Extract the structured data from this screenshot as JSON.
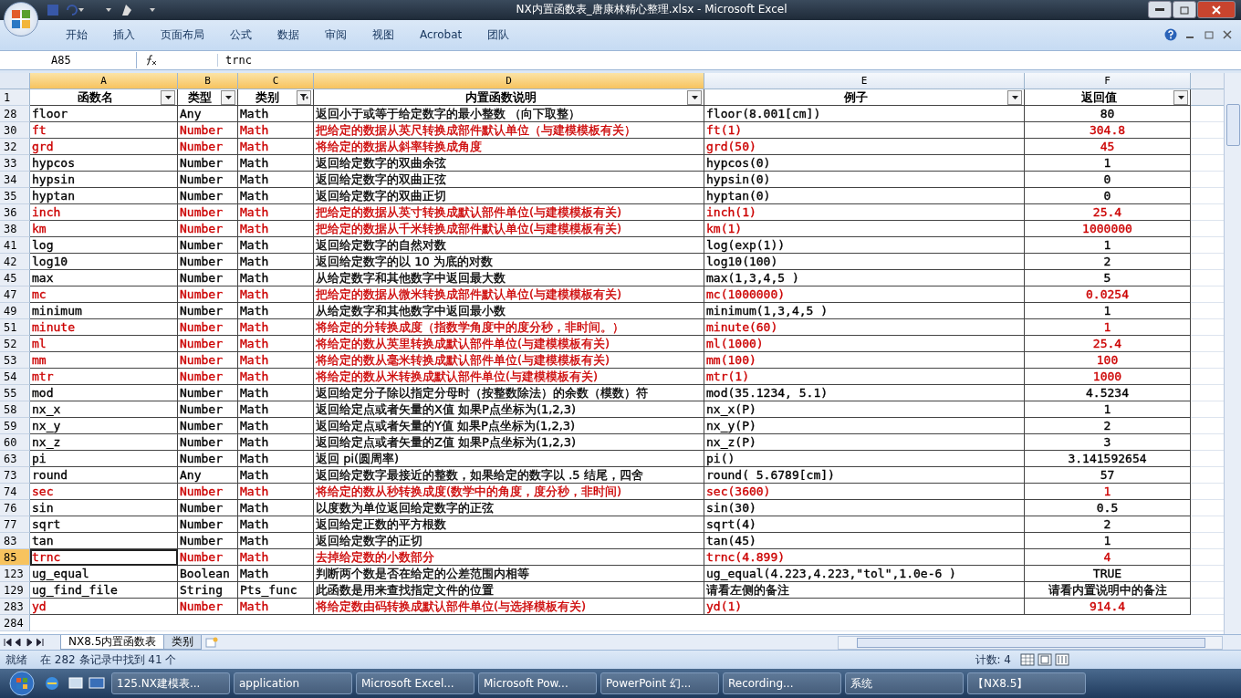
{
  "window": {
    "title": "NX内置函数表_唐康林精心整理.xlsx - Microsoft Excel"
  },
  "ribbon_tabs": [
    "开始",
    "插入",
    "页面布局",
    "公式",
    "数据",
    "审阅",
    "视图",
    "Acrobat",
    "团队"
  ],
  "formula_bar": {
    "name_box": "A85",
    "value": "trnc"
  },
  "columns": [
    {
      "letter": "A",
      "label": "函数名",
      "selected": true,
      "filtered": false
    },
    {
      "letter": "B",
      "label": "类型",
      "selected": true,
      "filtered": false
    },
    {
      "letter": "C",
      "label": "类别",
      "selected": true,
      "filtered": true
    },
    {
      "letter": "D",
      "label": "内置函数说明",
      "selected": true,
      "filtered": false
    },
    {
      "letter": "E",
      "label": "例子",
      "selected": false,
      "filtered": false
    },
    {
      "letter": "F",
      "label": "返回值",
      "selected": false,
      "filtered": false
    }
  ],
  "header_row": "1",
  "rows": [
    {
      "row": "28",
      "cells": [
        "floor",
        "Any",
        "Math",
        "返回小于或等于给定数字的最小整数 （向下取整）",
        "floor(8.001[cm])",
        "80"
      ],
      "color": "#000000",
      "selected": false
    },
    {
      "row": "30",
      "cells": [
        "ft",
        "Number",
        "Math",
        "把给定的数据从英尺转换成部件默认单位（与建模模板有关）",
        "ft(1)",
        "304.8"
      ],
      "color": "#cc0000",
      "selected": false
    },
    {
      "row": "32",
      "cells": [
        "grd",
        "Number",
        "Math",
        "将给定的数据从斜率转换成角度",
        "grd(50)",
        "45"
      ],
      "color": "#cc0000",
      "selected": false
    },
    {
      "row": "33",
      "cells": [
        "hypcos",
        "Number",
        "Math",
        "返回给定数字的双曲余弦",
        "hypcos(0)",
        "1"
      ],
      "color": "#000000",
      "selected": false
    },
    {
      "row": "34",
      "cells": [
        "hypsin",
        "Number",
        "Math",
        "返回给定数字的双曲正弦",
        "hypsin(0)",
        "0"
      ],
      "color": "#000000",
      "selected": false
    },
    {
      "row": "35",
      "cells": [
        "hyptan",
        "Number",
        "Math",
        "返回给定数字的双曲正切",
        "hyptan(0)",
        "0"
      ],
      "color": "#000000",
      "selected": false
    },
    {
      "row": "36",
      "cells": [
        "inch",
        "Number",
        "Math",
        "把给定的数据从英寸转换成默认部件单位(与建模模板有关)",
        "inch(1)",
        "25.4"
      ],
      "color": "#cc0000",
      "selected": false
    },
    {
      "row": "38",
      "cells": [
        "km",
        "Number",
        "Math",
        "把给定的数据从千米转换成部件默认单位(与建模模板有关)",
        "km(1)",
        "1000000"
      ],
      "color": "#cc0000",
      "selected": false
    },
    {
      "row": "41",
      "cells": [
        "log",
        "Number",
        "Math",
        "返回给定数字的自然对数",
        "log(exp(1))",
        "1"
      ],
      "color": "#000000",
      "selected": false
    },
    {
      "row": "42",
      "cells": [
        "log10",
        "Number",
        "Math",
        "返回给定数字的以 10 为底的对数",
        "log10(100)",
        "2"
      ],
      "color": "#000000",
      "selected": false
    },
    {
      "row": "45",
      "cells": [
        "max",
        "Number",
        "Math",
        "从给定数字和其他数字中返回最大数",
        "max(1,3,4,5 )",
        "5"
      ],
      "color": "#000000",
      "selected": false
    },
    {
      "row": "47",
      "cells": [
        "mc",
        "Number",
        "Math",
        "把给定的数据从微米转换成部件默认单位(与建模模板有关)",
        "mc(1000000)",
        "0.0254"
      ],
      "color": "#cc0000",
      "selected": false
    },
    {
      "row": "49",
      "cells": [
        "minimum",
        "Number",
        "Math",
        "从给定数字和其他数字中返回最小数",
        "minimum(1,3,4,5 )",
        "1"
      ],
      "color": "#000000",
      "selected": false
    },
    {
      "row": "51",
      "cells": [
        "minute",
        "Number",
        "Math",
        "将给定的分转换成度（指数学角度中的度分秒，非时间。）",
        "minute(60)",
        "1"
      ],
      "color": "#cc0000",
      "selected": false
    },
    {
      "row": "52",
      "cells": [
        "ml",
        "Number",
        "Math",
        "将给定的数从英里转换成默认部件单位(与建模模板有关)",
        "ml(1000)",
        "25.4"
      ],
      "color": "#cc0000",
      "selected": false
    },
    {
      "row": "53",
      "cells": [
        "mm",
        "Number",
        "Math",
        "将给定的数从毫米转换成默认部件单位(与建模模板有关)",
        "mm(100)",
        "100"
      ],
      "color": "#cc0000",
      "selected": false
    },
    {
      "row": "54",
      "cells": [
        "mtr",
        "Number",
        "Math",
        "将给定的数从米转换成默认部件单位(与建模模板有关)",
        "mtr(1)",
        "1000"
      ],
      "color": "#cc0000",
      "selected": false
    },
    {
      "row": "55",
      "cells": [
        "mod",
        "Number",
        "Math",
        "返回给定分子除以指定分母时（按整数除法）的余数（模数）符",
        "mod(35.1234, 5.1)",
        "4.5234"
      ],
      "color": "#000000",
      "selected": false
    },
    {
      "row": "58",
      "cells": [
        "nx_x",
        "Number",
        "Math",
        "返回给定点或者矢量的X值 如果P点坐标为(1,2,3)",
        "nx_x(P)",
        "1"
      ],
      "color": "#000000",
      "selected": false
    },
    {
      "row": "59",
      "cells": [
        "nx_y",
        "Number",
        "Math",
        "返回给定点或者矢量的Y值 如果P点坐标为(1,2,3)",
        "nx_y(P)",
        "2"
      ],
      "color": "#000000",
      "selected": false
    },
    {
      "row": "60",
      "cells": [
        "nx_z",
        "Number",
        "Math",
        "返回给定点或者矢量的Z值 如果P点坐标为(1,2,3)",
        "nx_z(P)",
        "3"
      ],
      "color": "#000000",
      "selected": false
    },
    {
      "row": "63",
      "cells": [
        "pi",
        "Number",
        "Math",
        "返回 pi(圆周率)",
        "pi()",
        "3.141592654"
      ],
      "color": "#000000",
      "selected": false
    },
    {
      "row": "73",
      "cells": [
        "round",
        "Any",
        "Math",
        "返回给定数字最接近的整数，如果给定的数字以 .5 结尾，四舍",
        "round( 5.6789[cm])",
        "57"
      ],
      "color": "#000000",
      "selected": false
    },
    {
      "row": "74",
      "cells": [
        "sec",
        "Number",
        "Math",
        "将给定的数从秒转换成度(数学中的角度，度分秒，非时间)",
        "sec(3600)",
        "1"
      ],
      "color": "#cc0000",
      "selected": false
    },
    {
      "row": "76",
      "cells": [
        "sin",
        "Number",
        "Math",
        "以度数为单位返回给定数字的正弦",
        "sin(30)",
        "0.5"
      ],
      "color": "#000000",
      "selected": false
    },
    {
      "row": "77",
      "cells": [
        "sqrt",
        "Number",
        "Math",
        "返回给定正数的平方根数",
        "sqrt(4)",
        "2"
      ],
      "color": "#000000",
      "selected": false
    },
    {
      "row": "83",
      "cells": [
        "tan",
        "Number",
        "Math",
        "返回给定数字的正切",
        "tan(45)",
        "1"
      ],
      "color": "#000000",
      "selected": false
    },
    {
      "row": "85",
      "cells": [
        "trnc",
        "Number",
        "Math",
        "去掉给定数的小数部分",
        "trnc(4.899)",
        "4"
      ],
      "color": "#cc0000",
      "selected": true
    },
    {
      "row": "123",
      "cells": [
        "ug_equal",
        "Boolean",
        "Math",
        "判断两个数是否在给定的公差范围内相等",
        "ug_equal(4.223,4.223,\"tol\",1.0e-6 )",
        "TRUE"
      ],
      "color": "#000000",
      "selected": false
    },
    {
      "row": "129",
      "cells": [
        "ug_find_file",
        "String",
        "Pts_func",
        "此函数是用来查找指定文件的位置",
        "请看左侧的备注",
        "请看内置说明中的备注"
      ],
      "color": "#000000",
      "selected": false
    },
    {
      "row": "283",
      "cells": [
        "yd",
        "Number",
        "Math",
        "将给定数由码转换成默认部件单位(与选择模板有关)",
        "yd(1)",
        "914.4"
      ],
      "color": "#cc0000",
      "selected": false
    }
  ],
  "empty_rows": [
    "284"
  ],
  "sheet_tabs": [
    {
      "label": "NX8.5内置函数表",
      "selected": true
    },
    {
      "label": "类别",
      "selected": false
    }
  ],
  "status_bar": {
    "ready": "就绪",
    "filter_info": "在 282 条记录中找到 41 个",
    "count": "计数: 4"
  },
  "taskbar": [
    "125.NX建模表...",
    "application",
    "Microsoft Excel...",
    "Microsoft Pow...",
    "PowerPoint 幻...",
    "Recording...",
    "系统",
    "【NX8.5】"
  ]
}
